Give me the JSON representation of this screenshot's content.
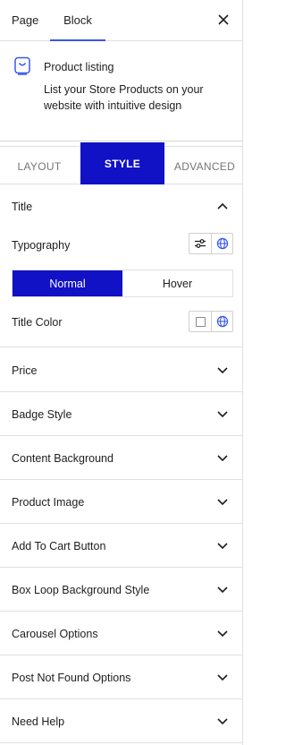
{
  "top_tabs": {
    "page": "Page",
    "block": "Block"
  },
  "block": {
    "name": "Product listing",
    "description": "List your Store Products on your website with intuitive design"
  },
  "style_tabs": {
    "layout": "LAYOUT",
    "style": "STYLE",
    "advanced": "ADVANCED"
  },
  "title_section": {
    "label": "Title",
    "typography_label": "Typography",
    "state_normal": "Normal",
    "state_hover": "Hover",
    "color_label": "Title Color"
  },
  "sections": [
    {
      "label": "Price"
    },
    {
      "label": "Badge Style"
    },
    {
      "label": "Content Background"
    },
    {
      "label": "Product Image"
    },
    {
      "label": "Add To Cart Button"
    },
    {
      "label": "Box Loop Background Style"
    },
    {
      "label": "Carousel Options"
    },
    {
      "label": "Post Not Found Options"
    },
    {
      "label": "Need Help"
    }
  ],
  "colors": {
    "accent": "#1111c6",
    "tab_underline": "#3858e9",
    "icon": "#3858e9"
  }
}
